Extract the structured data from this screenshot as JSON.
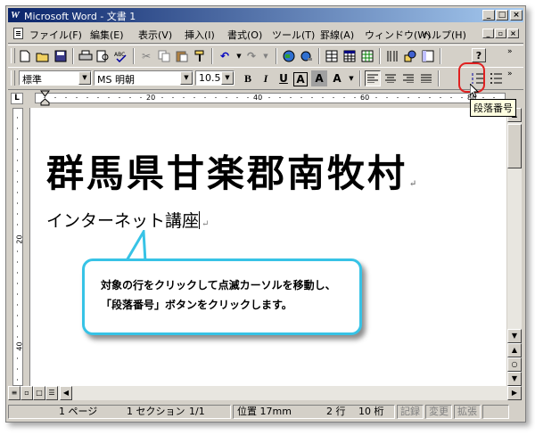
{
  "window": {
    "title": "Microsoft Word - 文書 1",
    "app_icon_glyph": "W"
  },
  "window_buttons": [
    "_",
    "□",
    "×"
  ],
  "mdi_buttons": [
    "_",
    "▫",
    "×"
  ],
  "menu": [
    "ファイル(F)",
    "編集(E)",
    "表示(V)",
    "挿入(I)",
    "書式(O)",
    "ツール(T)",
    "罫線(A)",
    "ウィンドウ(W)",
    "ヘルプ(H)"
  ],
  "standard_toolbar": {
    "icons": [
      "new-document-icon",
      "open-folder-icon",
      "save-icon",
      "print-icon",
      "print-preview-icon",
      "spelling-icon",
      "cut-icon",
      "copy-icon",
      "paste-icon",
      "format-painter-icon",
      "undo-icon",
      "redo-icon",
      "web-toolbar-icon",
      "hyperlink-icon",
      "tables-borders-icon",
      "insert-table-icon",
      "insert-excel-icon",
      "columns-icon",
      "drawing-icon",
      "document-map-icon",
      "help-icon"
    ],
    "undo_glyph": "↶",
    "redo_glyph": "↷",
    "help_glyph": "?"
  },
  "format_toolbar": {
    "style": "標準",
    "font": "MS 明朝",
    "size": "10.5",
    "bold": "B",
    "italic": "I",
    "underline": "U",
    "char_border": "A",
    "char_shading": "A",
    "scale": "A"
  },
  "ruler": {
    "h_numbers": [
      "20",
      "40",
      "60",
      "80"
    ],
    "v_numbers": [
      "20",
      "40"
    ],
    "tab_selector": "L"
  },
  "document": {
    "line1": "群馬県甘楽郡南牧村",
    "line2": "インターネット講座",
    "para_mark": "↵"
  },
  "tooltip": "段落番号",
  "callout": {
    "line1": "対象の行をクリックして点滅カーソルを移動し、",
    "line2": "「段落番号」ボタンをクリックします。"
  },
  "statusbar": {
    "page": "1 ページ",
    "section": "1 セクション",
    "pages": "1/1",
    "position": "位置 17mm",
    "line": "2 行",
    "column": "10 桁",
    "rec": "記録",
    "trk": "変更",
    "ext": "拡張"
  },
  "colors": {
    "titlebar_start": "#0a246a",
    "titlebar_end": "#a6caf0",
    "callout_border": "#37c3e6",
    "highlight": "#e02020",
    "tooltip_bg": "#ffffe1"
  }
}
